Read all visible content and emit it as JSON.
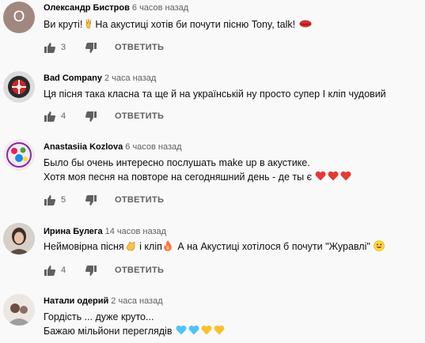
{
  "comments": [
    {
      "author": "Олександр Бистров",
      "time": "6 часов назад",
      "avatar_letter": "О",
      "text_pre": "Ви круті!",
      "text_post": "На акустиці хотів би почути пісню Tony, talk!",
      "likes": "3",
      "reply": "ОТВЕТИТЬ"
    },
    {
      "author": "Bad Company",
      "time": "2 часа назад",
      "text": "Ця пісня така класна та ще й на українській ну просто супер  І кліп чудовий",
      "likes": "4",
      "reply": "ОТВЕТИТЬ"
    },
    {
      "author": "Anastasiia Kozlova",
      "time": "6 часов назад",
      "line1": "Было бы очень интересно послушать make up в акустике.",
      "line2": "Хотя  моя песня на повторе на сегодняшний день - де ты є",
      "likes": "5",
      "reply": "ОТВЕТИТЬ"
    },
    {
      "author": "Ирина Булега",
      "time": "14 часов назад",
      "seg1": "Неймовірна пісня",
      "seg2": " і кліп",
      "seg3": " А на Акустиці хотілося б почути \"Журавлі\"",
      "likes": "4",
      "reply": "ОТВЕТИТЬ"
    },
    {
      "author": "Натали одерий",
      "time": "2 часа назад",
      "line1": "Гордість ... дуже круто...",
      "line2": "Бажаю мільйони переглядів"
    }
  ],
  "icons": {
    "like": "thumb-up-icon",
    "dislike": "thumb-down-icon"
  },
  "colors": {
    "avatar_letter_bg": "#a1887f",
    "heart_red": "#e53935",
    "heart_blue": "#4fc3f7",
    "heart_yellow": "#fbc02d"
  }
}
